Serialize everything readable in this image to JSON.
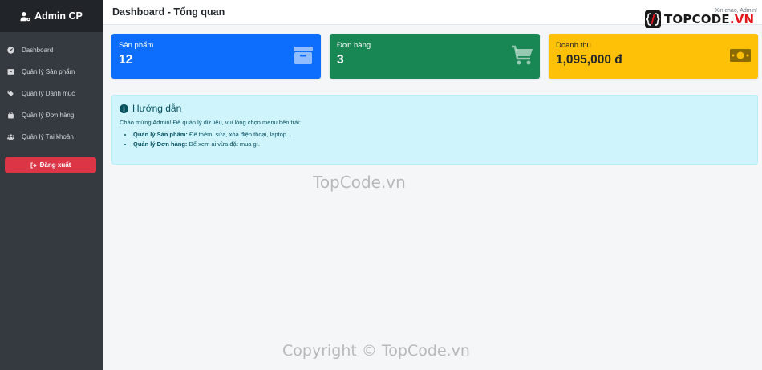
{
  "sidebar": {
    "brand": "Admin CP",
    "items": [
      {
        "label": "Dashboard",
        "icon": "dashboard-icon"
      },
      {
        "label": "Quản lý Sản phẩm",
        "icon": "box-icon"
      },
      {
        "label": "Quản lý Danh mục",
        "icon": "tags-icon"
      },
      {
        "label": "Quản lý Đơn hàng",
        "icon": "shopping-bag-icon"
      },
      {
        "label": "Quản lý Tài khoản",
        "icon": "users-icon"
      }
    ],
    "logout_label": "Đăng xuất"
  },
  "header": {
    "title": "Dashboard - Tổng quan",
    "greeting": "Xin chào, Admin!"
  },
  "watermark": {
    "logo_text": "TOPCODE",
    "logo_domain": ".VN",
    "center_text": "TopCode.vn",
    "copyright": "Copyright © TopCode.vn"
  },
  "stats": {
    "products": {
      "label": "Sản phẩm",
      "value": "12",
      "color": "#0d6efd",
      "icon": "box-icon"
    },
    "orders": {
      "label": "Đơn hàng",
      "value": "3",
      "color": "#198754",
      "icon": "cart-icon"
    },
    "revenue": {
      "label": "Doanh thu",
      "value": "1,095,000 đ",
      "color": "#ffc107",
      "icon": "money-icon"
    }
  },
  "guide": {
    "title": "Hướng dẫn",
    "intro": "Chào mừng Admin! Để quản lý dữ liệu, vui lòng chọn menu bên trái:",
    "items": [
      {
        "bold": "Quản lý Sản phẩm:",
        "text": " Để thêm, sửa, xóa điện thoại, laptop..."
      },
      {
        "bold": "Quản lý Đơn hàng:",
        "text": " Để xem ai vừa đặt mua gì."
      }
    ]
  }
}
